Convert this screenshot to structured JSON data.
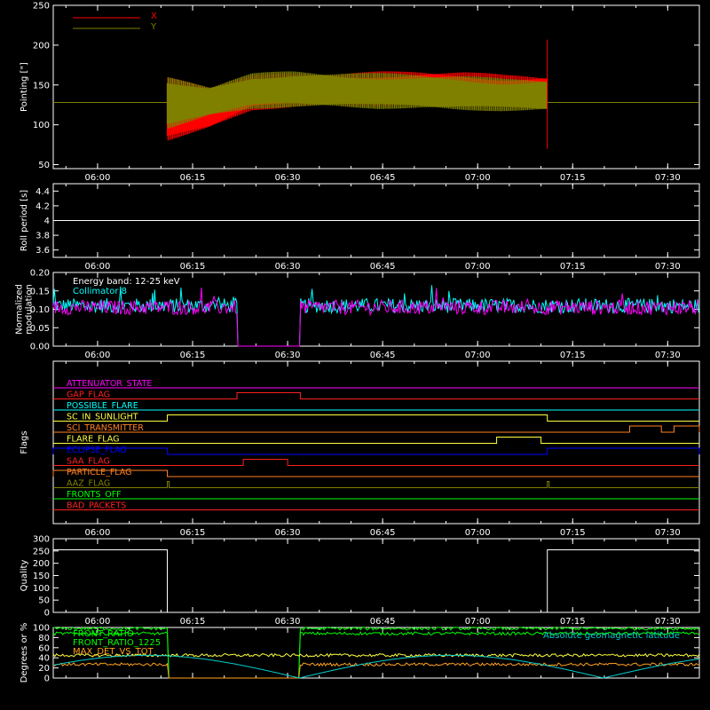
{
  "chart_data": [
    {
      "type": "line",
      "panel": "pointing",
      "ylabel": "Pointing [\"]",
      "ylim": [
        45,
        250
      ],
      "yticks": [
        50,
        100,
        150,
        200,
        250
      ],
      "xlim": [
        "05:53",
        "07:35"
      ],
      "xticks": [
        "06:00",
        "06:15",
        "06:30",
        "06:45",
        "07:00",
        "07:15",
        "07:30"
      ],
      "legend": "top-left",
      "series": [
        {
          "name": "X",
          "color": "#ff0000",
          "t_start": "06:11",
          "t_end": "07:11",
          "upper_env": [
            160,
            150,
            162,
            165,
            165,
            167,
            168,
            167,
            163,
            162
          ],
          "lower_env": [
            80,
            95,
            118,
            122,
            124,
            124,
            125,
            125,
            125,
            125
          ]
        },
        {
          "name": "Y",
          "color": "#808000",
          "t_start": "06:11",
          "t_end": "07:11",
          "upper_env": [
            160,
            150,
            165,
            168,
            166,
            165,
            164,
            162,
            158,
            158
          ],
          "lower_env": [
            95,
            110,
            120,
            122,
            122,
            120,
            120,
            118,
            117,
            117
          ]
        }
      ],
      "baseline": 128
    },
    {
      "type": "line",
      "panel": "roll",
      "ylabel": "Roll period [s]",
      "ylim": [
        3.5,
        4.5
      ],
      "yticks": [
        3.6,
        3.8,
        4.0,
        4.2,
        4.4
      ],
      "xlim": [
        "05:53",
        "07:35"
      ],
      "xticks": [
        "06:00",
        "06:15",
        "06:30",
        "06:45",
        "07:00",
        "07:15",
        "07:30"
      ],
      "series": [
        {
          "name": "",
          "color": "#ffffff",
          "constant": 4.0
        }
      ]
    },
    {
      "type": "line",
      "panel": "modulation",
      "ylabel": "Normalized modulation",
      "ylabel_lines": [
        "Normalized",
        "modulation"
      ],
      "ylim": [
        0,
        0.2
      ],
      "yticks": [
        "0.00",
        "0.05",
        "0.10",
        "0.15",
        "0.20"
      ],
      "xlim": [
        "05:53",
        "07:35"
      ],
      "xticks": [
        "06:00",
        "06:15",
        "06:30",
        "06:45",
        "07:00",
        "07:15",
        "07:30"
      ],
      "annotations": [
        "Energy band: 12-25 keV",
        "Collimator 8"
      ],
      "series": [
        {
          "name": "Collimator 8",
          "color": "#00ffff",
          "mean": 0.11,
          "gap": [
            "06:22",
            "06:32"
          ]
        },
        {
          "name": "",
          "color": "#ff00ff",
          "mean": 0.105,
          "gap": [
            "06:22",
            "06:32"
          ]
        }
      ]
    },
    {
      "type": "line",
      "panel": "flags",
      "ylabel": "Flags",
      "xlim": [
        "05:53",
        "07:35"
      ],
      "xticks": [
        "06:00",
        "06:15",
        "06:30",
        "06:45",
        "07:00",
        "07:15",
        "07:30"
      ],
      "flags": [
        {
          "name": "ATTENUATOR_STATE",
          "color": "#ff00ff",
          "on": []
        },
        {
          "name": "GAP_FLAG",
          "color": "#ff2020",
          "on": [
            [
              "06:22",
              "06:32"
            ]
          ]
        },
        {
          "name": "POSSIBLE_FLARE",
          "color": "#00ffff",
          "on": []
        },
        {
          "name": "SC_IN_SUNLIGHT",
          "color": "#ffff40",
          "on": [
            [
              "06:11",
              "07:11"
            ]
          ]
        },
        {
          "name": "SCI_TRANSMITTER",
          "color": "#ff8020",
          "on": [
            [
              "07:24",
              "07:29"
            ],
            [
              "07:31",
              "07:35"
            ]
          ]
        },
        {
          "name": "FLARE_FLAG",
          "color": "#ffff40",
          "on": [
            [
              "07:03",
              "07:10"
            ]
          ]
        },
        {
          "name": "ECLIPSE_FLAG",
          "color": "#0000ff",
          "on": [
            [
              "05:53",
              "06:11"
            ],
            [
              "07:11",
              "07:35"
            ]
          ]
        },
        {
          "name": "SAA_FLAG",
          "color": "#ff2020",
          "on": [
            [
              "06:23",
              "06:30"
            ]
          ]
        },
        {
          "name": "PARTICLE_FLAG",
          "color": "#ff8020",
          "on": [
            [
              "05:53",
              "06:11"
            ]
          ]
        },
        {
          "name": "AAZ_FLAG",
          "color": "#808000",
          "on": [
            [
              "06:11",
              "06:11"
            ],
            [
              "07:11",
              "07:11"
            ]
          ]
        },
        {
          "name": "FRONTS_OFF",
          "color": "#00ff00",
          "on": []
        },
        {
          "name": "BAD_PACKETS",
          "color": "#ff2020",
          "on": []
        }
      ]
    },
    {
      "type": "line",
      "panel": "quality",
      "ylabel": "Quality",
      "ylim": [
        0,
        300
      ],
      "yticks": [
        0,
        50,
        100,
        150,
        200,
        250,
        300
      ],
      "xlim": [
        "05:53",
        "07:35"
      ],
      "xticks": [
        "06:00",
        "06:15",
        "06:30",
        "06:45",
        "07:00",
        "07:15",
        "07:30"
      ],
      "series": [
        {
          "name": "",
          "color": "#ffffff",
          "segments": [
            [
              "05:53",
              "06:11",
              255
            ],
            [
              "06:11",
              "07:11",
              0
            ],
            [
              "07:11",
              "07:35",
              255
            ]
          ]
        }
      ]
    },
    {
      "type": "line",
      "panel": "degrees",
      "ylabel": "Degrees or %",
      "ylim": [
        0,
        100
      ],
      "yticks": [
        0,
        20,
        40,
        60,
        80,
        100
      ],
      "xlim": [
        "05:53",
        "07:35"
      ],
      "xticks": [],
      "series": [
        {
          "name": "FRONT_RATIO",
          "color": "#00ff00",
          "level": 88
        },
        {
          "name": "FRONT_RATIO_1225",
          "color": "#00ff00",
          "level": 98
        },
        {
          "name": "MAX_DET_VS_TOT",
          "color": "#ffa020",
          "level": 27
        },
        {
          "name": "",
          "color": "#ffff40",
          "level": 45
        },
        {
          "name": "Absolute geomagnetic latitude",
          "color": "#00cccc",
          "amplitude": 45
        }
      ]
    }
  ],
  "colors": {
    "background": "#000000",
    "axes": "#ffffff"
  }
}
